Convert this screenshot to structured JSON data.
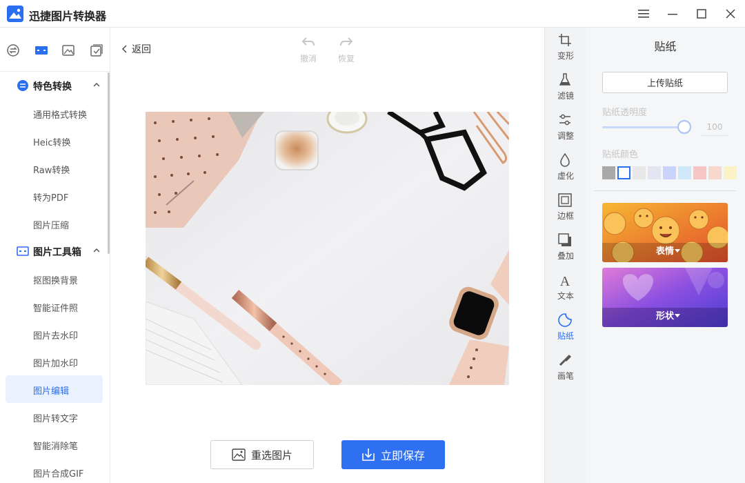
{
  "app": {
    "title": "迅捷图片转换器"
  },
  "window": {
    "menu_icon": "hamburger-menu-icon",
    "minimize_icon": "minimize-icon",
    "maximize_icon": "maximize-icon",
    "close_icon": "close-icon"
  },
  "sidebar": {
    "top_tabs": [
      {
        "icon": "convert-icon"
      },
      {
        "icon": "toolbox-icon",
        "active": true
      },
      {
        "icon": "image-icon"
      },
      {
        "icon": "check-square-icon"
      }
    ],
    "categories": [
      {
        "label": "特色转换",
        "items": [
          "通用格式转换",
          "Heic转换",
          "Raw转换",
          "转为PDF",
          "图片压缩"
        ]
      },
      {
        "label": "图片工具箱",
        "items": [
          "抠图换背景",
          "智能证件照",
          "图片去水印",
          "图片加水印",
          "图片编辑",
          "图片转文字",
          "智能消除笔",
          "图片合成GIF"
        ]
      }
    ],
    "active_item": "图片编辑"
  },
  "editor": {
    "back_label": "返回",
    "undo_label": "撤消",
    "redo_label": "恢复",
    "reselect_label": "重选图片",
    "save_label": "立即保存"
  },
  "tools": [
    {
      "label": "变形",
      "icon": "crop-icon"
    },
    {
      "label": "滤镜",
      "icon": "filter-flask-icon"
    },
    {
      "label": "调整",
      "icon": "adjust-sliders-icon"
    },
    {
      "label": "虚化",
      "icon": "blur-drop-icon"
    },
    {
      "label": "边框",
      "icon": "frame-icon"
    },
    {
      "label": "叠加",
      "icon": "overlay-icon"
    },
    {
      "label": "文本",
      "icon": "text-icon"
    },
    {
      "label": "贴纸",
      "icon": "sticker-icon",
      "active": true
    },
    {
      "label": "画笔",
      "icon": "brush-icon"
    }
  ],
  "panel": {
    "title": "贴纸",
    "upload_label": "上传贴纸",
    "opacity_label": "贴纸透明度",
    "opacity_value": "100",
    "opacity_fraction": 1.0,
    "color_label": "贴纸颜色",
    "colors": [
      "#a9a9a9",
      "#ffffff",
      "#e8e8e8",
      "#e3e6f2",
      "#c9d3fb",
      "#cfe9fb",
      "#f6c6c6",
      "#f8d8cc",
      "#fbf3c6"
    ],
    "selected_color_index": 1,
    "sticker_categories": [
      {
        "label": "表情"
      },
      {
        "label": "形状"
      }
    ]
  },
  "colors": {
    "accent": "#2f6ff2",
    "active_bg": "#eaf1ff"
  }
}
